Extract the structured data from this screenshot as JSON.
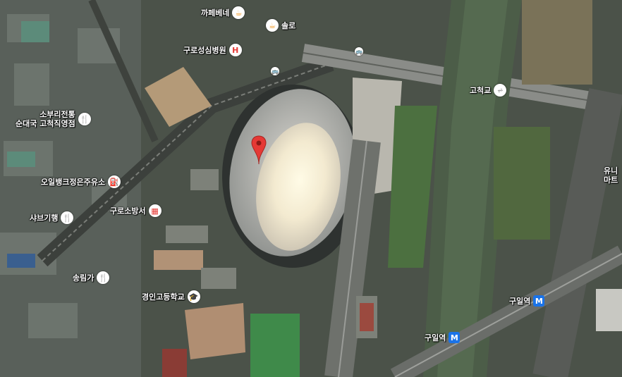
{
  "map": {
    "type": "satellite",
    "pois": [
      {
        "id": "cafe-bene",
        "label": "까페베네",
        "icon": "cafe-icon"
      },
      {
        "id": "solo",
        "label": "솔로",
        "icon": "cafe-icon"
      },
      {
        "id": "guro-hospital",
        "label": "구로성심병원",
        "icon": "hospital-icon"
      },
      {
        "id": "gocheok-bridge",
        "label": "고척교",
        "icon": "bridge-icon"
      },
      {
        "id": "sundae",
        "label1": "소부리전통",
        "label2": "순대국 고척직영점",
        "icon": "restaurant-icon"
      },
      {
        "id": "gas",
        "label": "오일뱅크정은주유소",
        "icon": "gas-station-icon"
      },
      {
        "id": "fire",
        "label": "구로소방서",
        "icon": "fire-station-icon"
      },
      {
        "id": "shabu",
        "label": "샤브기행",
        "icon": "restaurant-icon"
      },
      {
        "id": "songrim",
        "label": "송림가",
        "icon": "restaurant-icon"
      },
      {
        "id": "school",
        "label": "경인고등학교",
        "icon": "school-icon"
      },
      {
        "id": "guil1",
        "label": "구일역",
        "icon": "metro-icon"
      },
      {
        "id": "guil2",
        "label": "구일역",
        "icon": "metro-icon"
      },
      {
        "id": "edge",
        "label1": "유니",
        "label2": "마트"
      }
    ],
    "icons": {
      "metro": "M",
      "bus": "🚌"
    },
    "colors": {
      "accent": "#1a73e8",
      "pin": "#e53935",
      "food": "#f29e2e"
    }
  }
}
